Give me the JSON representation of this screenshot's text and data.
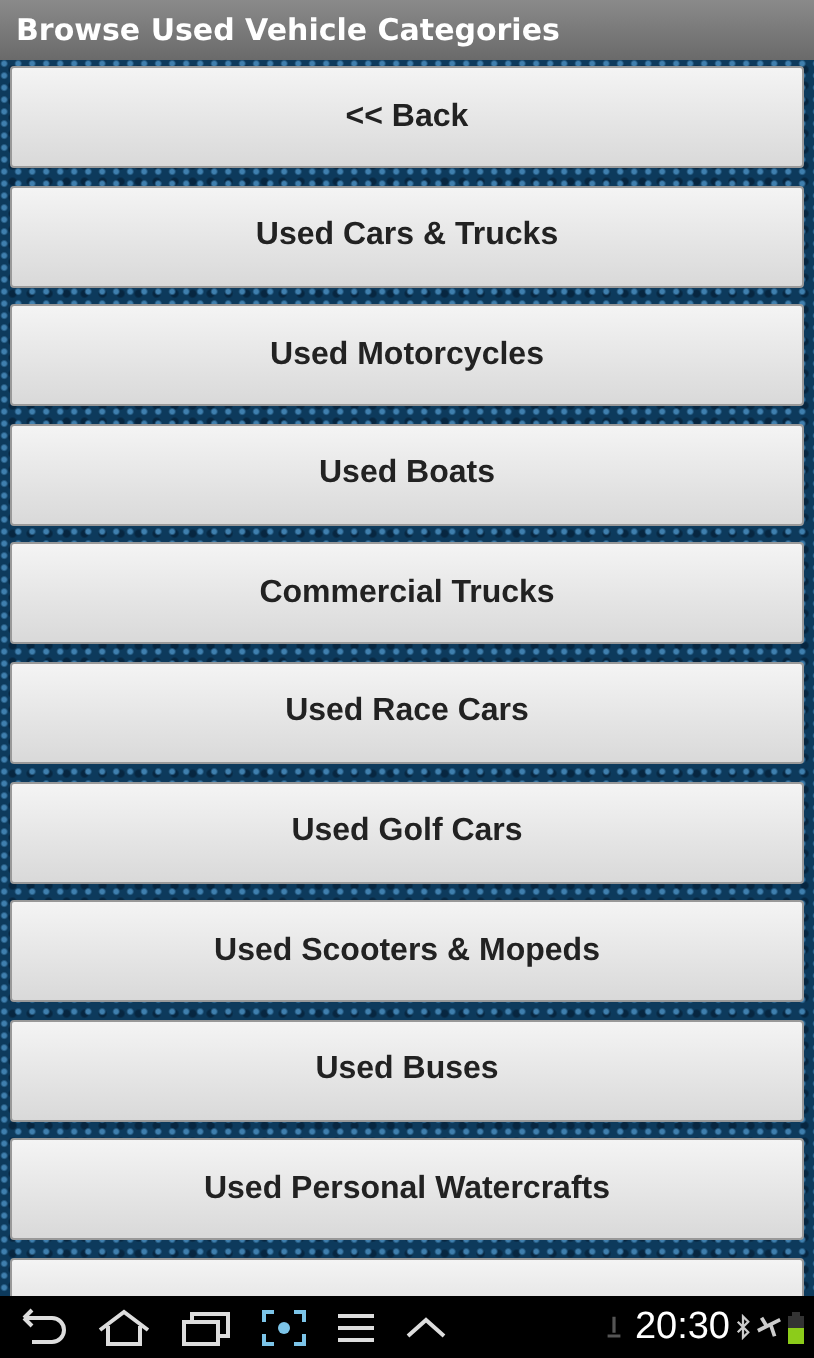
{
  "window": {
    "title": "Browse Used Vehicle Categories"
  },
  "buttons": [
    {
      "label": "<< Back"
    },
    {
      "label": "Used Cars & Trucks"
    },
    {
      "label": "Used Motorcycles"
    },
    {
      "label": "Used Boats"
    },
    {
      "label": "Commercial Trucks"
    },
    {
      "label": "Used Race Cars"
    },
    {
      "label": "Used Golf Cars"
    },
    {
      "label": "Used Scooters & Mopeds"
    },
    {
      "label": "Used Buses"
    },
    {
      "label": "Used Personal Watercrafts"
    }
  ],
  "status_bar": {
    "time": "20:30"
  }
}
